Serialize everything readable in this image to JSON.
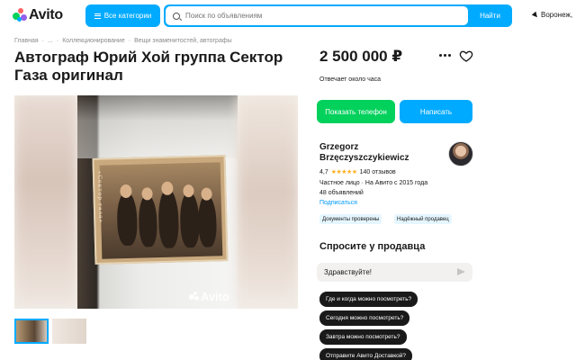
{
  "header": {
    "logo_text": "Avito",
    "categories_label": "Все категории",
    "search_placeholder": "Поиск по объявлениям",
    "search_button": "Найти",
    "location": "Воронеж,"
  },
  "breadcrumbs": [
    "Главная",
    "·",
    "...",
    "·",
    "Коллекционирование",
    "·",
    "Вещи знаменитостей, автографы"
  ],
  "listing": {
    "title": "Автограф Юрий Хой группа Сектор Газа оригинал",
    "photo_caption": "«Сектор газа»",
    "watermark": "Avito",
    "price": "2 500 000 ₽",
    "response_time": "Отвечает около часа",
    "show_phone_label": "Показать телефон",
    "write_label": "Написать"
  },
  "seller": {
    "name": "Grzegorz Brzęczyszczykiewicz",
    "rating": "4,7",
    "stars": "★★★★★",
    "reviews": "140 отзывов",
    "type": "Частное лицо · На Авито с 2015 года",
    "ads_count": "48 объявлений",
    "subscribe": "Подписаться",
    "badges": [
      "Документы проверены",
      "Надёжный продавец"
    ]
  },
  "ask": {
    "title": "Спросите у продавца",
    "message": "Здравствуйте!",
    "quick_questions": [
      "Где и когда можно посмотреть?",
      "Сегодня можно посмотреть?",
      "Завтра можно посмотреть?",
      "Отправите Авито Доставкой?"
    ]
  },
  "colors": {
    "accent_blue": "#00aaff",
    "accent_green": "#02d15c",
    "star": "#ffb021"
  }
}
